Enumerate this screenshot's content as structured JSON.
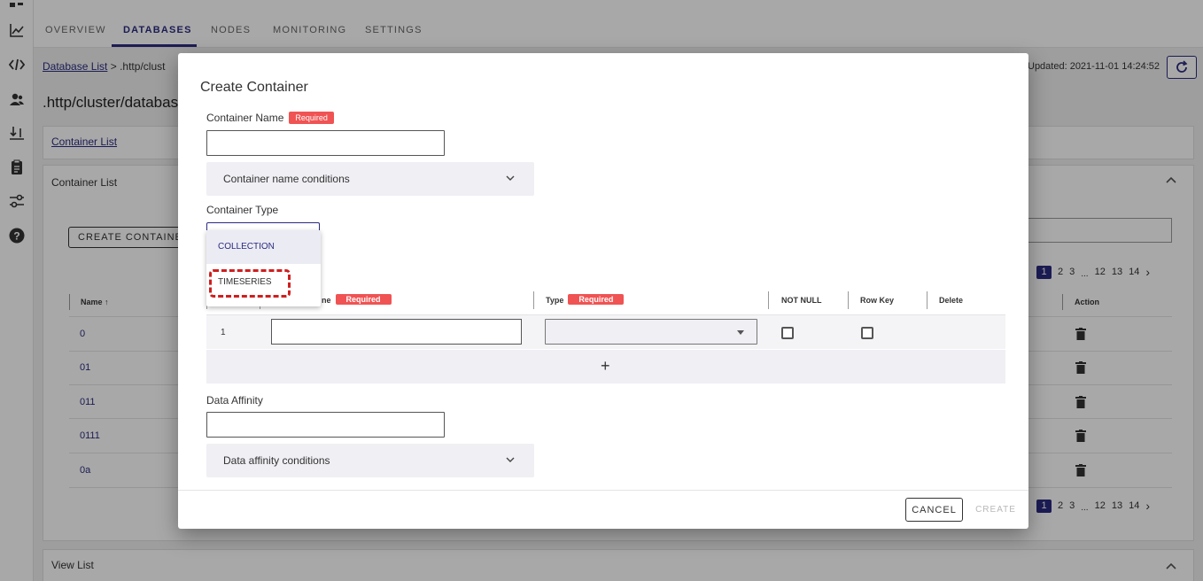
{
  "nav": {
    "tabs": [
      {
        "label": "OVERVIEW"
      },
      {
        "label": "DATABASES"
      },
      {
        "label": "NODES"
      },
      {
        "label": "MONITORING"
      },
      {
        "label": "SETTINGS"
      }
    ],
    "rail_icons": [
      "chart-line-icon",
      "code-icon",
      "users-icon",
      "import-export-icon",
      "clipboard-icon",
      "settings-sliders-icon",
      "help-icon"
    ]
  },
  "page": {
    "breadcrumb_link": "Database List",
    "breadcrumb_sep": ">",
    "breadcrumb_current": ".http/clust",
    "title": ".http/cluster/databas",
    "updated": "Updated: 2021-11-01 14:24:52",
    "container_list_link": "Container List",
    "container_list_title": "Container List",
    "create_container_label": "CREATE CONTAINER",
    "view_list_title": "View List",
    "table_header_name": "Name",
    "table_header_sort": "↑",
    "table_header_action": "Action",
    "rows": [
      "0",
      "01",
      "011",
      "0111",
      "0a"
    ],
    "pager": {
      "current": "1",
      "pages": [
        "2",
        "3"
      ],
      "ellipsis": "...",
      "tail": [
        "12",
        "13",
        "14"
      ],
      "next": "›"
    }
  },
  "dialog": {
    "title": "Create Container",
    "container_name_label": "Container Name",
    "required": "Required",
    "container_name_value": "",
    "name_conditions_label": "Container name conditions",
    "container_type_label": "Container Type",
    "type_options": [
      "COLLECTION",
      "TIMESERIES"
    ],
    "type_highlighted": "COLLECTION",
    "columns": {
      "name_header_fragment": "ne",
      "type_header": "Type",
      "not_null_header": "NOT NULL",
      "row_key_header": "Row Key",
      "delete_header": "Delete",
      "row_number": "1",
      "add_symbol": "+"
    },
    "data_affinity_label": "Data Affinity",
    "data_affinity_value": "",
    "affinity_conditions_label": "Data affinity conditions",
    "cancel_label": "CANCEL",
    "create_label": "CREATE"
  },
  "colors": {
    "accent": "#2b2b82",
    "required_badge": "#f05353",
    "focus_outline": "#cf1e1e"
  }
}
